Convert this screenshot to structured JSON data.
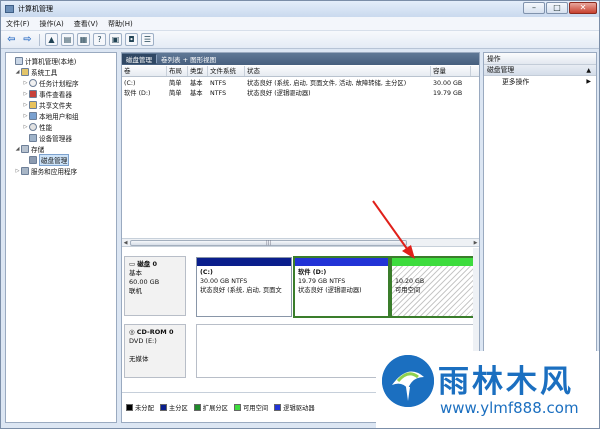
{
  "window": {
    "title": "计算机管理"
  },
  "menu": [
    "文件(F)",
    "操作(A)",
    "查看(V)",
    "帮助(H)"
  ],
  "toolbar": {
    "back_icon": "back-arrow-icon",
    "forward_icon": "forward-arrow-icon"
  },
  "tree": {
    "root": "计算机管理(本地)",
    "system_tools": "系统工具",
    "task_scheduler": "任务计划程序",
    "event_viewer": "事件查看器",
    "shared_folders": "共享文件夹",
    "local_users": "本地用户和组",
    "performance": "性能",
    "device_manager": "设备管理器",
    "storage": "存储",
    "disk_management": "磁盘管理",
    "services": "服务和应用程序"
  },
  "center": {
    "tabs": [
      "磁盘管理",
      "卷列表 + 图形视图"
    ],
    "columns": [
      "卷",
      "布局",
      "类型",
      "文件系统",
      "状态",
      "容量"
    ],
    "volumes": [
      {
        "name": "(C:)",
        "layout": "简单",
        "type": "基本",
        "fs": "NTFS",
        "status": "状态良好 (系统, 启动, 页面文件, 活动, 故障转储, 主分区)",
        "capacity": "30.00 GB"
      },
      {
        "name": "软件 (D:)",
        "layout": "简单",
        "type": "基本",
        "fs": "NTFS",
        "status": "状态良好 (逻辑驱动器)",
        "capacity": "19.79 GB"
      }
    ]
  },
  "disk0": {
    "title": "磁盘 0",
    "type": "基本",
    "size": "60.00 GB",
    "state": "联机",
    "partitions": [
      {
        "name": "(C:)",
        "size": "30.00 GB NTFS",
        "status": "状态良好 (系统, 启动, 页面文"
      },
      {
        "name": "软件  (D:)",
        "size": "19.79 GB NTFS",
        "status": "状态良好 (逻辑驱动器)"
      },
      {
        "name": "",
        "size": "10.20 GB",
        "status": "可用空间"
      }
    ]
  },
  "cdrom": {
    "title": "CD-ROM 0",
    "drive": "DVD (E:)",
    "media": "无媒体"
  },
  "legend": [
    {
      "label": "未分配",
      "color": "#000000"
    },
    {
      "label": "主分区",
      "color": "#0a1e8c"
    },
    {
      "label": "扩展分区",
      "color": "#1f8a2a"
    },
    {
      "label": "可用空间",
      "color": "#3ddc3d"
    },
    {
      "label": "逻辑驱动器",
      "color": "#2233d6"
    }
  ],
  "actions": {
    "header": "操作",
    "section": "磁盘管理",
    "more": "更多操作"
  },
  "watermark": {
    "name": "雨林木风",
    "url": "www.ylmf888.com"
  }
}
